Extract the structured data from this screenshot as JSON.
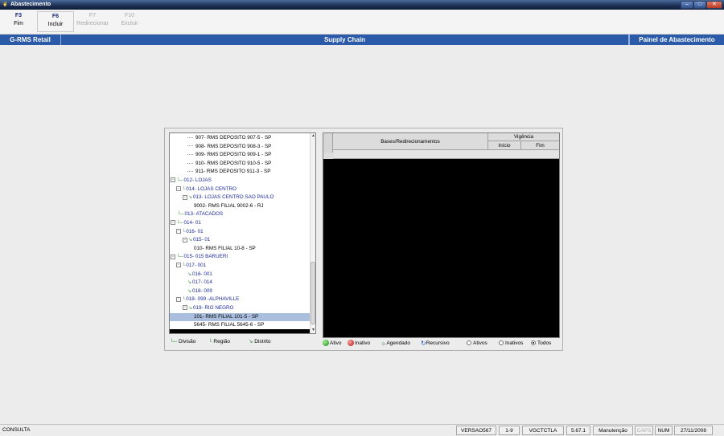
{
  "window": {
    "title": "Abastecimento",
    "app_icon": "leaf-icon"
  },
  "toolbar": {
    "keys": [
      {
        "key": "F3",
        "label": "Fim",
        "enabled": true
      },
      {
        "key": "F6",
        "label": "Incluir",
        "enabled": true
      },
      {
        "key": "F7",
        "label": "Redirecionar",
        "enabled": false
      },
      {
        "key": "F10",
        "label": "Excluir",
        "enabled": false
      }
    ]
  },
  "header": {
    "left": "G-RMS Retail",
    "center": "Supply Chain",
    "right": "Painel de Abastecimento"
  },
  "tree": {
    "rows": [
      {
        "text": "907- RMS DEPOSITO 907-5 - SP",
        "color": "black"
      },
      {
        "text": "908- RMS DEPOSITO 908-3 - SP",
        "color": "black"
      },
      {
        "text": "909- RMS DEPOSITO 909-1 - SP",
        "color": "black"
      },
      {
        "text": "910- RMS DEPOSITO 910-5 - SP",
        "color": "black"
      },
      {
        "text": "911- RMS DEPOSITO 911-3 - SP",
        "color": "black"
      },
      {
        "text": "012- LOJAS",
        "color": "blue"
      },
      {
        "text": "014- LOJAS CENTRO",
        "color": "blue"
      },
      {
        "text": "013- LOJAS CENTRO SAO PAULO",
        "color": "blue"
      },
      {
        "text": "9002- RMS FILIAL 9002-6 - RJ",
        "color": "black"
      },
      {
        "text": "013- ATACADOS",
        "color": "blue"
      },
      {
        "text": "014- 01",
        "color": "blue"
      },
      {
        "text": "016- 01",
        "color": "blue"
      },
      {
        "text": "015- 01",
        "color": "blue"
      },
      {
        "text": "010- RMS FILIAL 10-8 - SP",
        "color": "black"
      },
      {
        "text": "015- 015 BARUERI",
        "color": "blue"
      },
      {
        "text": "017- 001",
        "color": "blue"
      },
      {
        "text": "016- 001",
        "color": "blue"
      },
      {
        "text": "017- 014",
        "color": "blue"
      },
      {
        "text": "018- 009",
        "color": "blue"
      },
      {
        "text": "018- 099 -ALPHAVILLE",
        "color": "blue"
      },
      {
        "text": "019- RIO NEGRO",
        "color": "blue"
      },
      {
        "text": "101- RMS FILIAL 101-5 - SP",
        "color": "black",
        "selected": true
      },
      {
        "text": "5645- RMS FILIAL 5645-6 - SP",
        "color": "black"
      }
    ],
    "legend": {
      "divisao": "Divisão",
      "regiao": "Região",
      "distrito": "Distrito"
    }
  },
  "grid": {
    "col_bases": "Bases/Redirecionamentos",
    "col_vigencia": "Vigência",
    "col_inicio": "Início",
    "col_fim": "Fim"
  },
  "legend": {
    "ativo": "Ativo",
    "inativo": "Inativo",
    "agendado": "Agendado",
    "recursivo": "Recursivo",
    "radio_ativos": "Ativos",
    "radio_inativos": "Inativos",
    "radio_todos": "Todos",
    "selected_filter": "Todos"
  },
  "status": {
    "mode": "CONSULTA",
    "versao": "VERSAO567",
    "page": "1-9",
    "program": "VGCTCTLA",
    "build": "5.67.1",
    "operation": "Manutenção",
    "caps": "CAPS",
    "num": "NUM",
    "date": "27/11/2008"
  }
}
